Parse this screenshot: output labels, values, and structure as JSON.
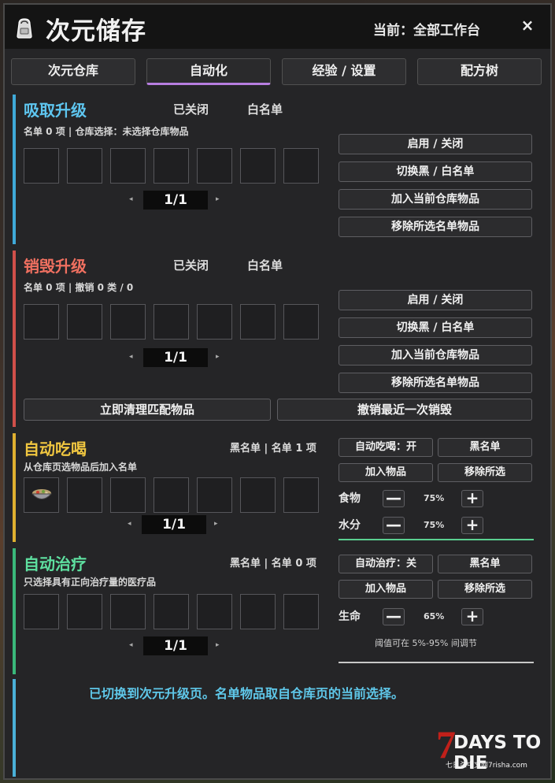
{
  "window": {
    "title": "次元储存",
    "current": "当前：全部工作台",
    "close": "×"
  },
  "tabs": [
    "次元仓库",
    "自动化",
    "经验 / 设置",
    "配方树"
  ],
  "absorb": {
    "title": "吸取升级",
    "state": "已关闭",
    "mode": "白名单",
    "sub": "名单 0 项 | 仓库选择：未选择仓库物品",
    "page": "1/1",
    "buttons": [
      "启用 / 关闭",
      "切换黑 / 白名单",
      "加入当前仓库物品",
      "移除所选名单物品"
    ]
  },
  "destroy": {
    "title": "销毁升级",
    "state": "已关闭",
    "mode": "白名单",
    "sub": "名单 0 项 | 撤销 0 类 / 0",
    "page": "1/1",
    "buttons": [
      "启用 / 关闭",
      "切换黑 / 白名单",
      "加入当前仓库物品",
      "移除所选名单物品"
    ],
    "clear_button": "立即清理匹配物品",
    "undo_button": "撤销最近一次销毁"
  },
  "autoeat": {
    "title": "自动吃喝",
    "status": "黑名单 | 名单 1 项",
    "sub": "从仓库页选物品后加入名单",
    "page": "1/1",
    "toggle": "自动吃喝：开",
    "mode": "黑名单",
    "add": "加入物品",
    "remove": "移除所选",
    "food_label": "食物",
    "food_value": "75%",
    "water_label": "水分",
    "water_value": "75%",
    "minus": "—",
    "plus": "+"
  },
  "autoheal": {
    "title": "自动治疗",
    "status": "黑名单 | 名单 0 项",
    "sub": "只选择具有正向治疗量的医疗品",
    "page": "1/1",
    "toggle": "自动治疗：关",
    "mode": "黑名单",
    "add": "加入物品",
    "remove": "移除所选",
    "life_label": "生命",
    "life_value": "65%",
    "hint": "阈值可在 5%-95% 间调节",
    "minus": "—",
    "plus": "+"
  },
  "status": "已切换到次元升级页。名单物品取自仓库页的当前选择。",
  "watermark": {
    "logo_num": "7",
    "logo": "DAYS TO DIE",
    "site": "七日杀中文网7risha.com"
  },
  "colors": {
    "absorb": "#3fa9d8",
    "destroy": "#d0504a",
    "autoeat": "#e0b030",
    "autoheal": "#3ab87a",
    "status": "#5fc8ea",
    "tab_active": "#b77ee0"
  }
}
